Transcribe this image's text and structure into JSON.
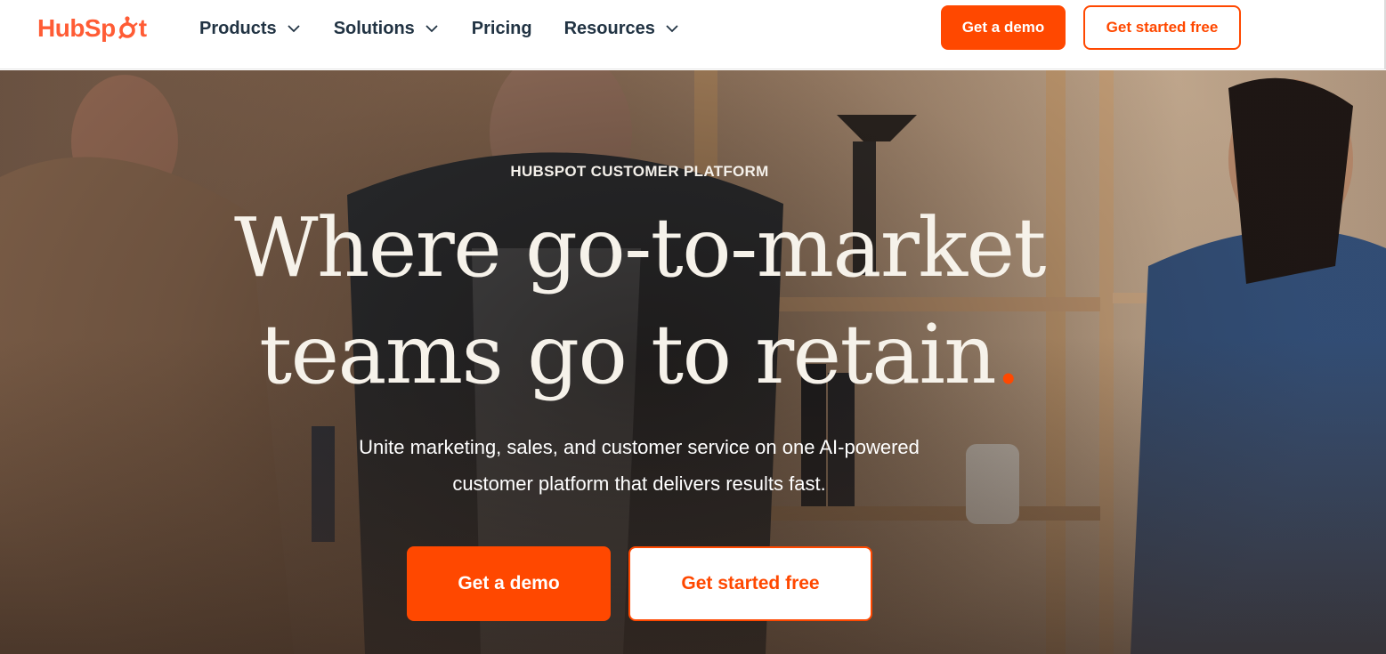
{
  "brand": {
    "logo_text_before": "HubSp",
    "logo_text_after": "t",
    "accent_color": "#ff4800",
    "logo_color": "#ff5c35",
    "text_dark": "#213343"
  },
  "nav": {
    "items": [
      {
        "label": "Products",
        "icon": "chevron-down-icon"
      },
      {
        "label": "Solutions",
        "icon": "chevron-down-icon"
      },
      {
        "label": "Pricing"
      },
      {
        "label": "Resources",
        "icon": "chevron-down-icon"
      }
    ],
    "demo_label": "Get a demo",
    "free_label": "Get started free"
  },
  "hero": {
    "eyebrow": "HUBSPOT CUSTOMER PLATFORM",
    "headline_line1": "Where go-to-market",
    "headline_line2": "teams go to retain",
    "headline_dot": ".",
    "subhead_line1": "Unite marketing, sales, and customer service on one AI-powered",
    "subhead_line2": "customer platform that delivers results fast.",
    "demo_label": "Get a demo",
    "free_label": "Get started free",
    "background": "hero-photo-office-team"
  }
}
